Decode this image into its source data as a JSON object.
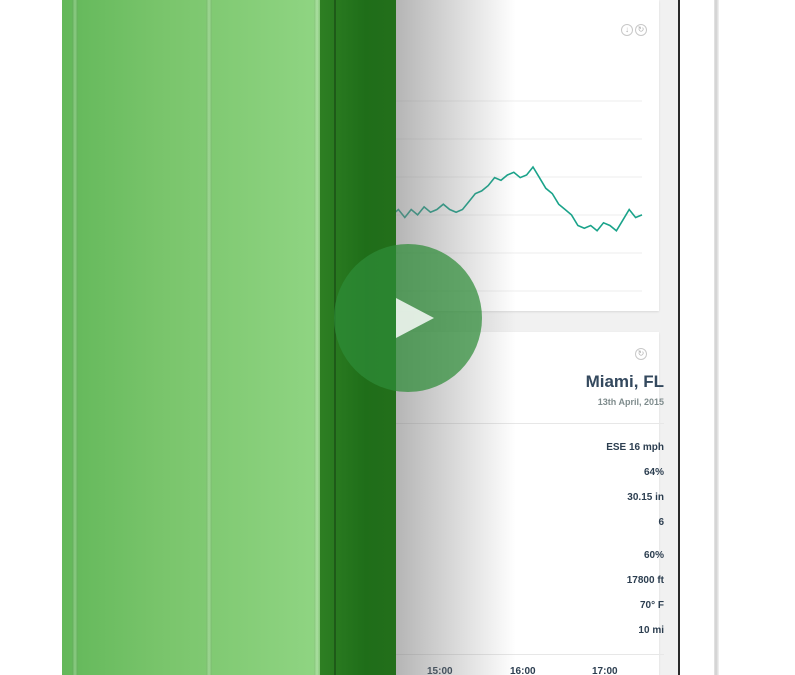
{
  "chart_card": {
    "download_icon": "download-icon",
    "refresh_icon": "refresh-icon",
    "accent_color": "#1aa38a"
  },
  "chart_data": {
    "type": "line",
    "series": [
      {
        "values": [
          29,
          31,
          28,
          31,
          29,
          32,
          30,
          31,
          33,
          31,
          30,
          31,
          34,
          37,
          38,
          40,
          43,
          42,
          44,
          45,
          43,
          44,
          47,
          43,
          39,
          37,
          33,
          31,
          29,
          25,
          24,
          25,
          23,
          26,
          25,
          23,
          27,
          31,
          28,
          29
        ]
      }
    ],
    "ylim": [
      0,
      100
    ],
    "grid": true
  },
  "weather_card": {
    "refresh_icon": "refresh-icon",
    "city": "Miami, FL",
    "date": "13th April, 2015",
    "stats_group_1": [
      "ESE 16 mph",
      "64%",
      "30.15 in",
      "6"
    ],
    "stats_group_2": [
      "60%",
      "17800 ft",
      "70° F",
      "10 mi"
    ],
    "times": [
      "15:00",
      "16:00",
      "17:00"
    ]
  },
  "colors": {
    "cover_green": "#7ac56c",
    "cover_dark_green": "#236f1b",
    "text_dark": "#34495e"
  }
}
